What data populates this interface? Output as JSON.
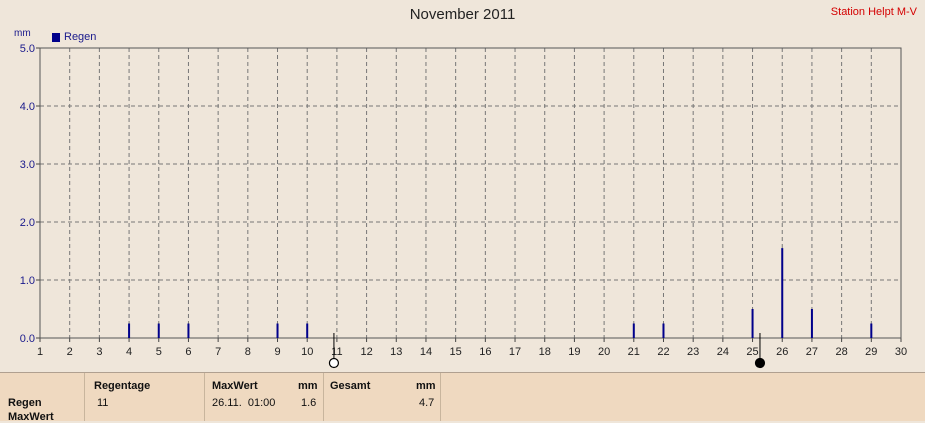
{
  "title": "November 2011",
  "station": "Station Helpt M-V",
  "unit": "mm",
  "legend": {
    "label": "Regen",
    "color": "#00008b"
  },
  "chart_data": {
    "type": "bar",
    "title": "November 2011",
    "ylabel": "mm",
    "xlim": [
      1,
      30
    ],
    "ylim": [
      0,
      5
    ],
    "x_ticks": [
      "1",
      "2",
      "3",
      "4",
      "5",
      "6",
      "7",
      "8",
      "9",
      "10",
      "11",
      "12",
      "13",
      "14",
      "15",
      "16",
      "17",
      "18",
      "19",
      "20",
      "21",
      "22",
      "23",
      "24",
      "25",
      "26",
      "27",
      "28",
      "29",
      "30"
    ],
    "y_ticks": [
      "0.0",
      "1.0",
      "2.0",
      "3.0",
      "4.0",
      "5.0"
    ],
    "grid": true,
    "legend_position": "top-left",
    "series": [
      {
        "name": "Regen",
        "color": "#00008b",
        "x": [
          4,
          5,
          6,
          9,
          10,
          21,
          22,
          25,
          26,
          27,
          29
        ],
        "values": [
          0.25,
          0.25,
          0.25,
          0.25,
          0.25,
          0.25,
          0.25,
          0.5,
          1.55,
          0.5,
          0.25
        ]
      }
    ],
    "moon_markers": [
      {
        "type": "full-moon",
        "x": 10.9
      },
      {
        "type": "new-moon",
        "x": 25.25
      }
    ]
  },
  "summary": {
    "row_labels": [
      "Regen",
      "MaxWert"
    ],
    "regentage": {
      "header": "Regentage",
      "value": "11"
    },
    "maxwert": {
      "header": "MaxWert",
      "unit": "mm",
      "date": "26.11.  01:00",
      "value": "1.6"
    },
    "gesamt": {
      "header": "Gesamt",
      "unit": "mm",
      "value": "4.7"
    }
  }
}
